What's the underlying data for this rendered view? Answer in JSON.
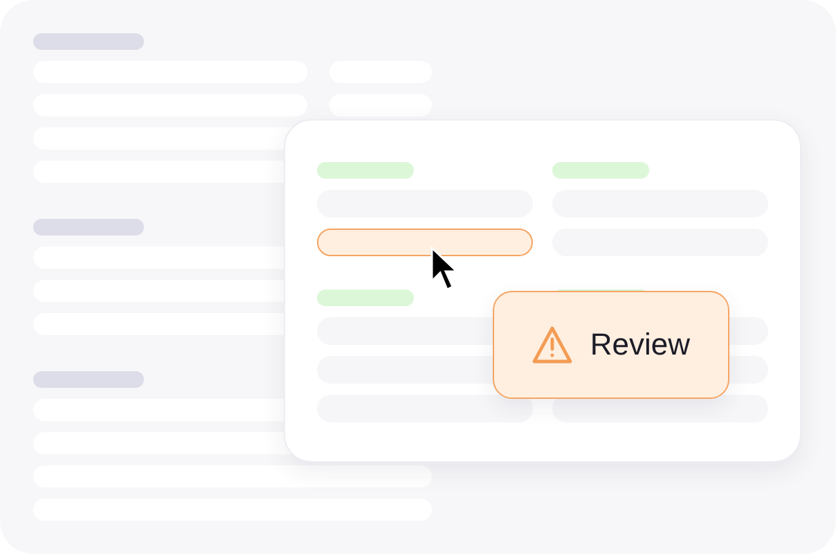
{
  "card": {
    "columns": [
      {
        "groups": [
          {
            "rows": [
              {
                "flagged": false
              },
              {
                "flagged": true
              }
            ]
          },
          {
            "rows": [
              {
                "flagged": false
              },
              {
                "flagged": false
              },
              {
                "flagged": false
              }
            ]
          }
        ]
      },
      {
        "groups": [
          {
            "rows": [
              {
                "flagged": false
              },
              {
                "flagged": false
              }
            ]
          },
          {
            "rows": [
              {
                "flagged": false
              },
              {
                "flagged": false
              },
              {
                "flagged": false
              }
            ]
          }
        ]
      }
    ]
  },
  "badge": {
    "label": "Review"
  }
}
